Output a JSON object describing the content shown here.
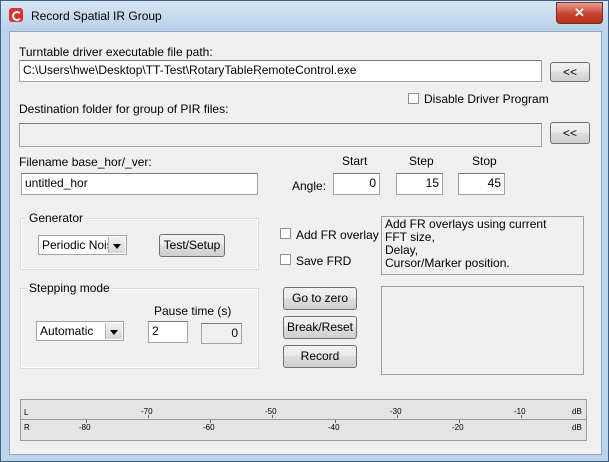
{
  "window": {
    "title": "Record Spatial IR Group",
    "close_label": "✕"
  },
  "driver": {
    "label": "Turntable driver executable file path:",
    "path": "C:\\Users\\hwe\\Desktop\\TT-Test\\RotaryTableRemoteControl.exe",
    "browse_label": "<<"
  },
  "destination": {
    "label": "Destination folder for group of PIR files:",
    "path": "",
    "browse_label": "<<",
    "disable_driver_label": "Disable Driver Program",
    "disable_driver_checked": false
  },
  "filename": {
    "label": "Filename base_hor/_ver:",
    "value": "untitled_hor"
  },
  "angle": {
    "label": "Angle:",
    "start_label": "Start",
    "step_label": "Step",
    "stop_label": "Stop",
    "start": "0",
    "step": "15",
    "stop": "45"
  },
  "generator": {
    "label": "Generator",
    "selected": "Periodic Noise",
    "test_button": "Test/Setup"
  },
  "overlay": {
    "add_fr_label": "Add FR overlay",
    "add_fr_checked": false,
    "save_frd_label": "Save FRD",
    "save_frd_checked": false,
    "info_lines": [
      "Add FR overlays using current",
      "FFT size,",
      "Delay,",
      "Cursor/Marker position."
    ]
  },
  "stepping": {
    "label": "Stepping mode",
    "selected": "Automatic",
    "pause_label": "Pause time (s)",
    "pause_value": "2",
    "counter_value": "0"
  },
  "actions": {
    "go_to_zero": "Go to zero",
    "break_reset": "Break/Reset",
    "record": "Record"
  },
  "meter": {
    "left": {
      "channel": "L",
      "ticks": [
        "-70",
        "-50",
        "-30",
        "-10"
      ],
      "unit": "dB"
    },
    "right": {
      "channel": "R",
      "ticks": [
        "-80",
        "-60",
        "-40",
        "-20"
      ],
      "unit": "dB"
    }
  }
}
